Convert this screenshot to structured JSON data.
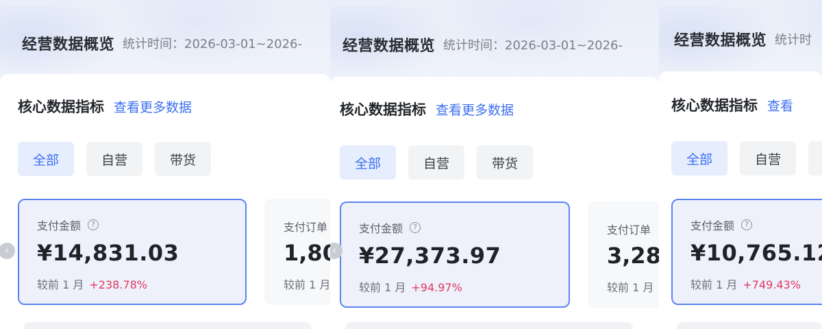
{
  "panels": [
    {
      "header": {
        "title": "经营数据概览",
        "range": "统计时间：2026-03-01~2026-"
      },
      "section": {
        "title": "核心数据指标",
        "link": "查看更多数据"
      },
      "tabs": [
        {
          "label": "全部",
          "active": true
        },
        {
          "label": "自营"
        },
        {
          "label": "带货"
        }
      ],
      "metric": {
        "label": "支付金额",
        "value": "¥14,831.03",
        "compare": "较前 1 月",
        "change": "+238.78%"
      },
      "side_metric": {
        "label": "支付订单",
        "value": "1,80",
        "compare": "较前 1 月"
      }
    },
    {
      "header": {
        "title": "经营数据概览",
        "range": "统计时间：2026-03-01~2026-"
      },
      "section": {
        "title": "核心数据指标",
        "link": "查看更多数据"
      },
      "tabs": [
        {
          "label": "全部",
          "active": true
        },
        {
          "label": "自营"
        },
        {
          "label": "带货"
        }
      ],
      "metric": {
        "label": "支付金额",
        "value": "¥27,373.97",
        "compare": "较前 1 月",
        "change": "+94.97%"
      },
      "side_metric": {
        "label": "支付订单",
        "value": "3,28",
        "compare": "较前 1 月"
      }
    },
    {
      "header": {
        "title": "经营数据概览",
        "range": "统计时"
      },
      "section": {
        "title": "核心数据指标",
        "link": "查看"
      },
      "tabs": [
        {
          "label": "全部",
          "active": true
        },
        {
          "label": "自营"
        },
        {
          "label": ""
        }
      ],
      "metric": {
        "label": "支付金额",
        "value": "¥10,765.12",
        "compare": "较前 1 月",
        "change": "+749.43%"
      }
    }
  ],
  "icons": {
    "help": "question-circle-icon",
    "carousel_prev": "chevron-left-icon"
  },
  "colors": {
    "accent": "#3d6ff0",
    "increase": "#e0395c",
    "selected_border": "#5a84f0"
  }
}
